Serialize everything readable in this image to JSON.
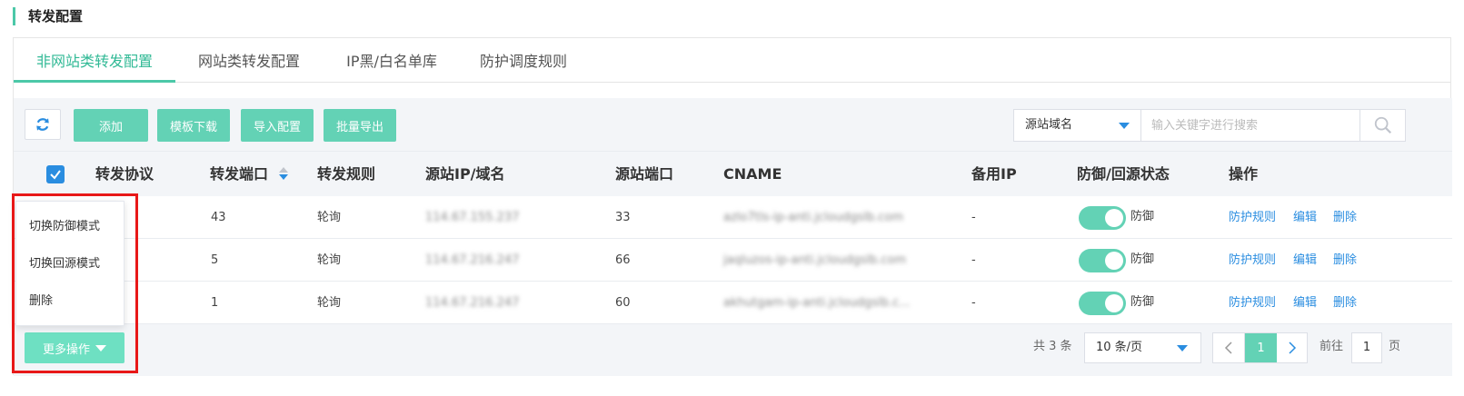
{
  "page_title": "转发配置",
  "tabs": [
    {
      "label": "非网站类转发配置",
      "active": true
    },
    {
      "label": "网站类转发配置",
      "active": false
    },
    {
      "label": "IP黑/白名单库",
      "active": false
    },
    {
      "label": "防护调度规则",
      "active": false
    }
  ],
  "toolbar": {
    "refresh_icon": "refresh-icon",
    "add_label": "添加",
    "template_download_label": "模板下载",
    "import_label": "导入配置",
    "batch_export_label": "批量导出"
  },
  "search": {
    "field_selected": "源站域名",
    "placeholder": "输入关键字进行搜索",
    "icon": "search-icon"
  },
  "table": {
    "headers": [
      "转发协议",
      "转发端口",
      "转发规则",
      "源站IP/域名",
      "源站端口",
      "CNAME",
      "备用IP",
      "防御/回源状态",
      "操作"
    ],
    "rows": [
      {
        "port": "43",
        "rule": "轮询",
        "source_ip": "114.67.155.237",
        "source_port": "33",
        "cname": "azlo7tls-ip-anti.jcloudgslb.com",
        "backup_ip": "-",
        "status": "防御",
        "actions": [
          "防护规则",
          "编辑",
          "删除"
        ]
      },
      {
        "port": "5",
        "rule": "轮询",
        "source_ip": "114.67.216.247",
        "source_port": "66",
        "cname": "jaqluzos-ip-anti.jcloudgslb.com",
        "backup_ip": "-",
        "status": "防御",
        "actions": [
          "防护规则",
          "编辑",
          "删除"
        ]
      },
      {
        "port": "1",
        "rule": "轮询",
        "source_ip": "114.67.216.247",
        "source_port": "60",
        "cname": "akhutgam-ip-anti.jcloudgslb.c...",
        "backup_ip": "-",
        "status": "防御",
        "actions": [
          "防护规则",
          "编辑",
          "删除"
        ]
      }
    ]
  },
  "more_actions": {
    "button_label": "更多操作",
    "menu": [
      "切换防御模式",
      "切换回源模式",
      "删除"
    ]
  },
  "pagination": {
    "total": "共 3 条",
    "page_size": "10 条/页",
    "current_page": "1",
    "goto_label": "前往",
    "goto_value": "1",
    "goto_unit": "页"
  },
  "colors": {
    "accent": "#4cc8a8",
    "button": "#63d2b5",
    "link": "#2a8de0",
    "highlight": "#e81818"
  }
}
